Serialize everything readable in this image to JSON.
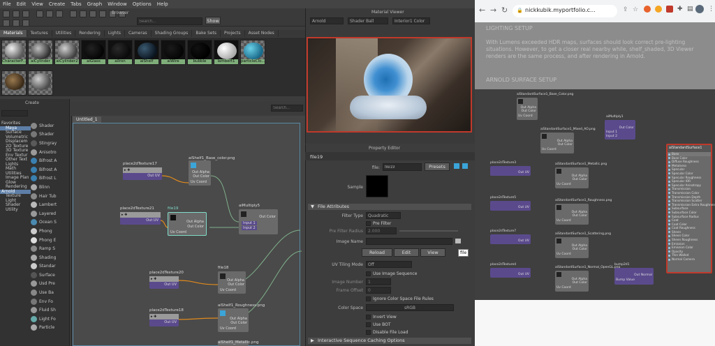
{
  "menu": [
    "File",
    "Edit",
    "View",
    "Create",
    "Tabs",
    "Graph",
    "Window",
    "Options",
    "Help"
  ],
  "browser": {
    "title": "Browser",
    "search_placeholder": "Search...",
    "show_label": "Show"
  },
  "browser_tabs": [
    "Materials",
    "Textures",
    "Utilities",
    "Rendering",
    "Lights",
    "Cameras",
    "Shading Groups",
    "Bake Sets",
    "Projects",
    "Asset Nodes"
  ],
  "swatches": [
    "CharacterF...",
    "aiCylinder",
    "aiCylinder2",
    "aiGlass",
    "aiIron",
    "aiShelf",
    "aiWire",
    "bubble",
    "lambert1",
    "particleClo...",
    "",
    ""
  ],
  "create": {
    "title": "Create"
  },
  "tree": [
    "Favorites",
    "Maya",
    "Surface",
    "Volumetric",
    "Displacem",
    "2D Texture",
    "3D Texture",
    "Env Textur",
    "Other Text",
    "Lights",
    "Math",
    "Utilities",
    "Image Plan",
    "Glow",
    "Rendering",
    "Arnold",
    "Texture",
    "Light",
    "Shader",
    "Utility"
  ],
  "node_list": [
    "Shader",
    "Shader",
    "Stingray",
    "Anisotro",
    "Bifrost A",
    "Bifrost A",
    "Bifrost L",
    "Blinn",
    "Hair Tub",
    "Lambert",
    "Layered",
    "Ocean S",
    "Phong",
    "Phong E",
    "Ramp S",
    "Shading",
    "Standar",
    "Surface",
    "Usd Pre",
    "Use Ba",
    "Env Fo",
    "Fluid Sh",
    "Light Fo",
    "Particle"
  ],
  "graph": {
    "tab": "Untitled_1",
    "search_placeholder": "Search...",
    "nodes": [
      {
        "name": "place2dTexture17",
        "out": "Out UV"
      },
      {
        "name": "aiShelf1_Base_color.png",
        "out1": "Out Alpha",
        "out2": "Out Color",
        "in": "Uv Coord"
      },
      {
        "name": "place2dTexture21",
        "out": "Out UV"
      },
      {
        "name": "file19",
        "out1": "Out Alpha",
        "out2": "Out Color",
        "in": "Uv Coord"
      },
      {
        "name": "aiMultiply5",
        "out": "Out Color",
        "in1": "Input 1",
        "in2": "Input 2"
      },
      {
        "name": "place2dTexture20",
        "out": "Out UV"
      },
      {
        "name": "file18",
        "out1": "Out Alpha",
        "out2": "Out Color",
        "in": "Uv Coord"
      },
      {
        "name": "place2dTexture18",
        "out": "Out UV"
      },
      {
        "name": "aiShelf1_Roughness.png",
        "out1": "Out Alpha",
        "out2": "Out Color",
        "in": "Uv Coord"
      },
      {
        "name": "aiShelf1_Metallic.png"
      }
    ]
  },
  "material_viewer": {
    "title": "Material Viewer",
    "renderer": "Arnold",
    "geometry": "Shader Ball",
    "env": "Interior1 Color"
  },
  "property_editor": {
    "title": "Property Editor",
    "node": "file19",
    "file_label": "file:",
    "file_value": "file19",
    "presets": "Presets",
    "sample": "Sample",
    "section_file_attr": "File Attributes",
    "filter_type_label": "Filter Type",
    "filter_type": "Quadratic",
    "pre_filter": "Pre Filter",
    "pre_filter_radius_label": "Pre Filter Radius",
    "pre_filter_radius": "2.000",
    "image_name_label": "Image Name",
    "reload": "Reload",
    "edit": "Edit",
    "view": "View",
    "tooltip": "file",
    "uv_tiling_label": "UV Tiling Mode",
    "uv_tiling": "Off",
    "use_image_sequence": "Use Image Sequence",
    "image_number_label": "Image Number",
    "image_number": "1",
    "frame_offset_label": "Frame Offset",
    "frame_offset": "0",
    "ignore_cs": "Ignore Color Space File Rules",
    "color_space_label": "Color Space",
    "color_space": "sRGB",
    "invert_view": "Invert View",
    "use_bot": "Use BOT",
    "disable_file_load": "Disable File Load",
    "section_caching": "Interactive Sequence Caching Options"
  },
  "chrome": {
    "url": "nickkubik.myportfolio.c..."
  },
  "web": {
    "heading": "LIGHTING SETUP",
    "para1": "With Lumens exceeded HDR maps, surfaces should look correct pre-lighting",
    "para2": "situations. However, to get a closer real nearby while, shelf_shaded, 3D Viewer",
    "para3": "renders are the same process, and after rendering in Arnold.",
    "subheading": "ARNOLD SURFACE SETUP"
  },
  "shade_nodes": [
    {
      "name": "aiStandardSurface1_Base_Color.png"
    },
    {
      "name": "aiMultiply1",
      "out": "Out Color",
      "in1": "Input 1",
      "in2": "Input 2"
    },
    {
      "name": "aiStandardSurface1_Mixed_AO.png"
    },
    {
      "name": "place2dTexture3",
      "out": "Out UV"
    },
    {
      "name": "aiStandardSurface1_Metallic.png"
    },
    {
      "name": "place2dTexture5",
      "out": "Out UV"
    },
    {
      "name": "aiStandardSurface1_Roughness.png"
    },
    {
      "name": "place2dTexture7",
      "out": "Out UV"
    },
    {
      "name": "aiStandardSurface1_Scattering.png"
    },
    {
      "name": "place2dTexture4",
      "out": "Out UV"
    },
    {
      "name": "aiStandardSurface1_Normal_OpenGL.png"
    },
    {
      "name": "bump2d1",
      "out": "Out Normal",
      "in": "Bump Value"
    }
  ],
  "shade_node_ports": {
    "out_alpha": "Out Alpha",
    "out_color": "Out Color",
    "uv_coord": "Uv Coord"
  },
  "big_node": {
    "name": "aiStandardSurface1",
    "attrs": [
      "Base",
      "Base Color",
      "Diffuse Roughness",
      "Metalness",
      "Specular",
      "Specular Color",
      "Specular Roughness",
      "Specular IOR",
      "Specular Anisotropy",
      "Transmission",
      "Transmission Color",
      "Transmission Depth",
      "Transmission Scatter",
      "Transmission Extra Roughness",
      "Subsurface",
      "Subsurface Color",
      "Subsurface Radius",
      "Coat",
      "Coat Color",
      "Coat Roughness",
      "Sheen",
      "Sheen Color",
      "Sheen Roughness",
      "Emission",
      "Emission Color",
      "Opacity",
      "Thin Walled",
      "Normal Camera"
    ]
  },
  "colors": {
    "accent_red": "#c0392b",
    "node_purple": "#5a4a8c",
    "tab_green": "#7fae7a",
    "selection_blue": "#5d7ea6"
  }
}
